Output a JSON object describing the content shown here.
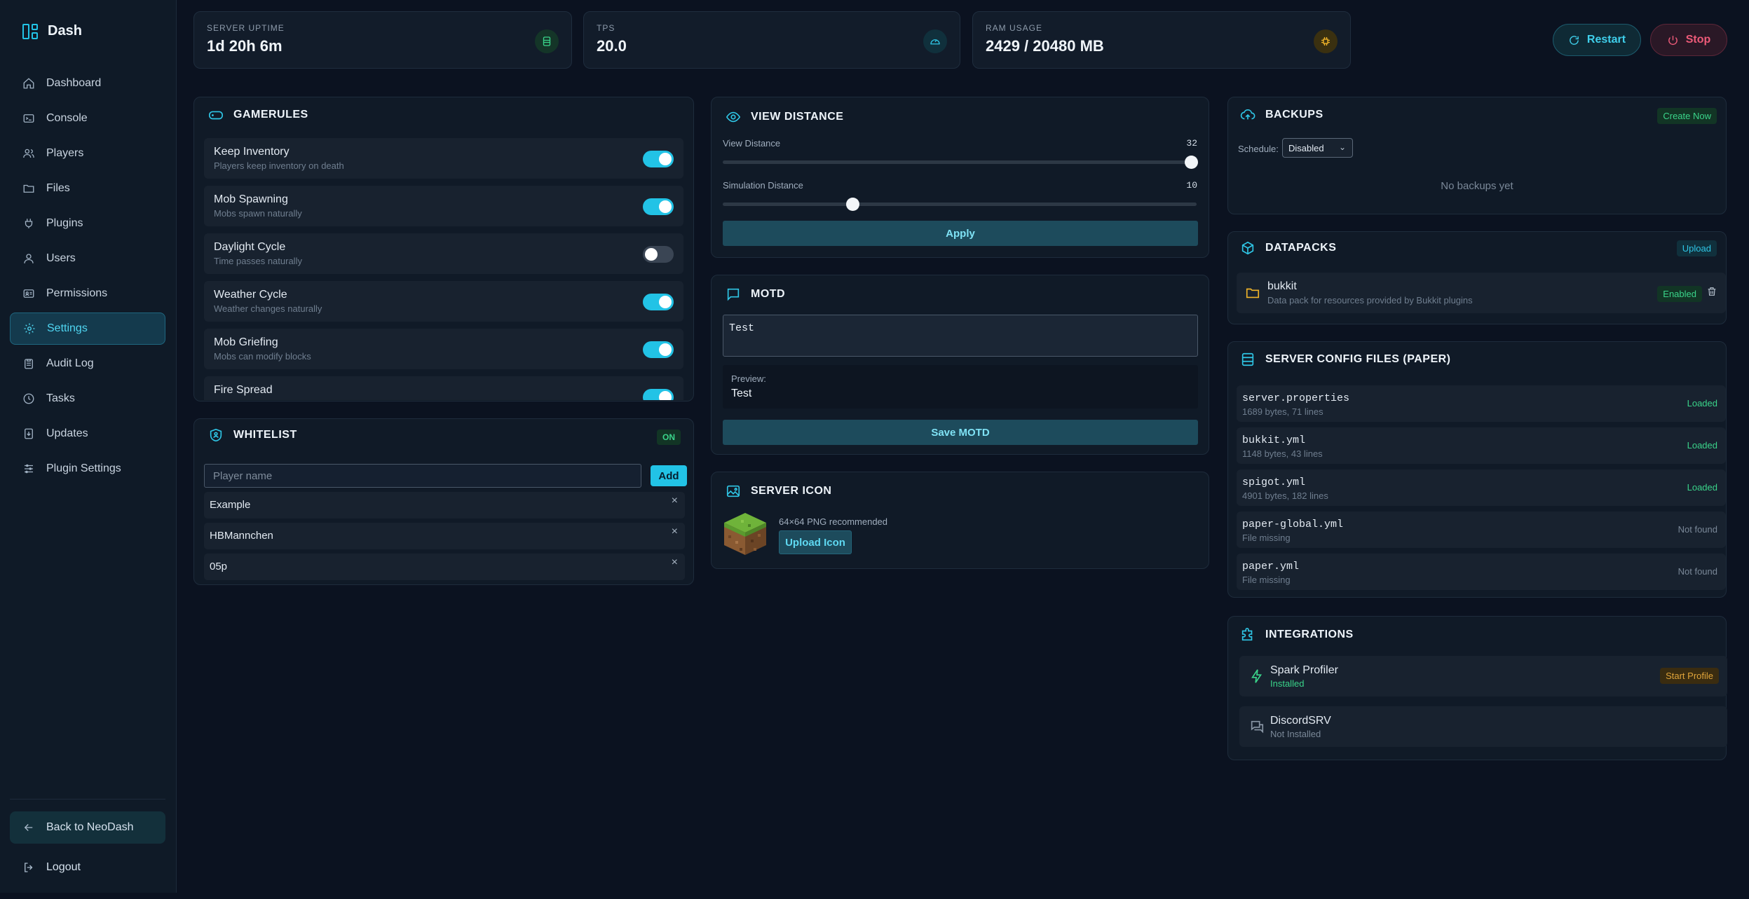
{
  "app": {
    "name": "Dash"
  },
  "sidebar": {
    "items": [
      {
        "label": "Dashboard",
        "icon": "home-icon"
      },
      {
        "label": "Console",
        "icon": "terminal-icon"
      },
      {
        "label": "Players",
        "icon": "users-icon"
      },
      {
        "label": "Files",
        "icon": "folder-icon"
      },
      {
        "label": "Plugins",
        "icon": "plug-icon"
      },
      {
        "label": "Users",
        "icon": "user-icon"
      },
      {
        "label": "Permissions",
        "icon": "id-card-icon"
      },
      {
        "label": "Settings",
        "icon": "gear-icon",
        "active": true
      },
      {
        "label": "Audit Log",
        "icon": "clipboard-icon"
      },
      {
        "label": "Tasks",
        "icon": "clock-icon"
      },
      {
        "label": "Updates",
        "icon": "download-icon"
      },
      {
        "label": "Plugin Settings",
        "icon": "sliders-icon"
      }
    ],
    "back_label": "Back to NeoDash",
    "logout_label": "Logout"
  },
  "stats": {
    "uptime": {
      "label": "SERVER UPTIME",
      "value": "1d 20h 6m"
    },
    "tps": {
      "label": "TPS",
      "value": "20.0"
    },
    "ram": {
      "label": "RAM USAGE",
      "value": "2429 / 20480 MB"
    }
  },
  "controls": {
    "restart_label": "Restart",
    "stop_label": "Stop"
  },
  "gamerules": {
    "title": "GAMERULES",
    "rules": [
      {
        "name": "Keep Inventory",
        "desc": "Players keep inventory on death",
        "enabled": true
      },
      {
        "name": "Mob Spawning",
        "desc": "Mobs spawn naturally",
        "enabled": true
      },
      {
        "name": "Daylight Cycle",
        "desc": "Time passes naturally",
        "enabled": false
      },
      {
        "name": "Weather Cycle",
        "desc": "Weather changes naturally",
        "enabled": true
      },
      {
        "name": "Mob Griefing",
        "desc": "Mobs can modify blocks",
        "enabled": true
      },
      {
        "name": "Fire Spread",
        "desc": "",
        "enabled": true
      }
    ]
  },
  "whitelist": {
    "title": "WHITELIST",
    "status": "ON",
    "placeholder": "Player name",
    "add_label": "Add",
    "players": [
      "Example",
      "HBMannchen",
      "05p"
    ],
    "remove_glyph": "×"
  },
  "view_distance": {
    "title": "VIEW DISTANCE",
    "view_label": "View Distance",
    "view_value": "32",
    "view_fraction": 0.988,
    "sim_label": "Simulation Distance",
    "sim_value": "10",
    "sim_fraction": 0.273,
    "apply_label": "Apply"
  },
  "motd": {
    "title": "MOTD",
    "value": "Test",
    "preview_label": "Preview:",
    "preview_value": "Test",
    "save_label": "Save MOTD"
  },
  "server_icon": {
    "title": "SERVER ICON",
    "hint": "64×64 PNG recommended",
    "upload_label": "Upload Icon"
  },
  "backups": {
    "title": "BACKUPS",
    "create_label": "Create Now",
    "schedule_label": "Schedule:",
    "schedule_value": "Disabled",
    "empty_text": "No backups yet"
  },
  "datapacks": {
    "title": "DATAPACKS",
    "upload_label": "Upload",
    "items": [
      {
        "name": "bukkit",
        "desc": "Data pack for resources provided by Bukkit plugins",
        "status": "Enabled"
      }
    ]
  },
  "config_files": {
    "title": "SERVER CONFIG FILES (PAPER)",
    "files": [
      {
        "name": "server.properties",
        "info": "1689 bytes, 71 lines",
        "status": "Loaded"
      },
      {
        "name": "bukkit.yml",
        "info": "1148 bytes, 43 lines",
        "status": "Loaded"
      },
      {
        "name": "spigot.yml",
        "info": "4901 bytes, 182 lines",
        "status": "Loaded"
      },
      {
        "name": "paper-global.yml",
        "info": "File missing",
        "status": "Not found"
      },
      {
        "name": "paper.yml",
        "info": "File missing",
        "status": "Not found"
      }
    ]
  },
  "integrations": {
    "title": "INTEGRATIONS",
    "items": [
      {
        "name": "Spark Profiler",
        "status": "Installed",
        "action": "Start Profile"
      },
      {
        "name": "DiscordSRV",
        "status": "Not Installed"
      }
    ]
  },
  "colors": {
    "accent": "#22c3e6",
    "success": "#3ad48a",
    "danger": "#ec5a78",
    "warning": "#e0a43a",
    "muted": "#7a8898"
  }
}
